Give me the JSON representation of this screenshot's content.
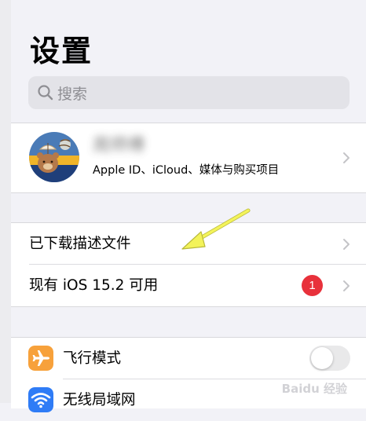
{
  "header": {
    "title": "设置"
  },
  "search": {
    "placeholder": "搜索",
    "icon": "search-icon"
  },
  "profile": {
    "name": "周师傅",
    "subtitle": "Apple ID、iCloud、媒体与购买项目",
    "avatar_colors": {
      "sky": "#4a7bb7",
      "sun": "#f0b429",
      "ground": "#1f3f7a"
    }
  },
  "updates": {
    "items": [
      {
        "label": "已下载描述文件"
      },
      {
        "label": "现有 iOS 15.2 可用",
        "badge": "1"
      }
    ]
  },
  "settings": {
    "items": [
      {
        "label": "飞行模式",
        "icon": "airplane-icon",
        "icon_color": "#f7a13b",
        "toggle_on": false
      },
      {
        "label": "无线局域网",
        "icon": "wifi-icon",
        "icon_color": "#2f7cf6"
      }
    ]
  },
  "annotation": {
    "arrow_color": "#f3f35a"
  },
  "watermark": {
    "text": "Baidu 经验"
  },
  "colors": {
    "background": "#f2f2f7",
    "badge": "#e8313b",
    "chevron": "#c4c4c7"
  }
}
